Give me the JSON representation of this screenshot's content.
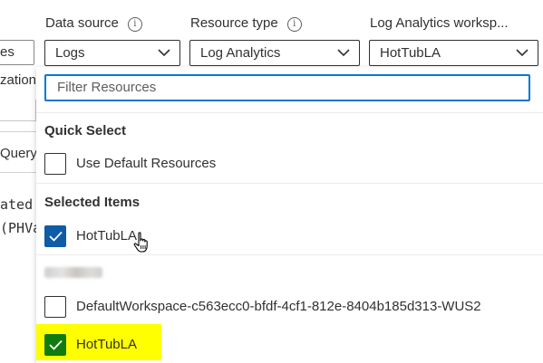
{
  "left": {
    "field_text": "es",
    "row2_text": "zation",
    "tab_text": "Query",
    "code_line1": "ated",
    "code_line2": "(PHVa"
  },
  "header": {
    "data_source": {
      "label": "Data source",
      "value": "Logs"
    },
    "resource_type": {
      "label": "Resource type",
      "value": "Log Analytics"
    },
    "workspace": {
      "label": "Log Analytics worksp...",
      "value": "HotTubLA"
    }
  },
  "panel": {
    "filter_placeholder": "Filter Resources",
    "quick_select": {
      "title": "Quick Select",
      "items": [
        {
          "label": "Use Default Resources",
          "checked": false
        }
      ]
    },
    "selected_items": {
      "title": "Selected Items",
      "items": [
        {
          "label": "HotTubLA",
          "checked": true
        }
      ]
    },
    "resource_group": {
      "items": [
        {
          "label": "DefaultWorkspace-c563ecc0-bfdf-4cf1-812e-8404b185d313-WUS2",
          "checked": false
        },
        {
          "label": "HotTubLA",
          "checked": true
        }
      ]
    }
  },
  "colors": {
    "accent": "#0078d4",
    "checked": "#0f5ba8",
    "checked_highlight": "#107c10",
    "highlight": "#ffff00"
  }
}
